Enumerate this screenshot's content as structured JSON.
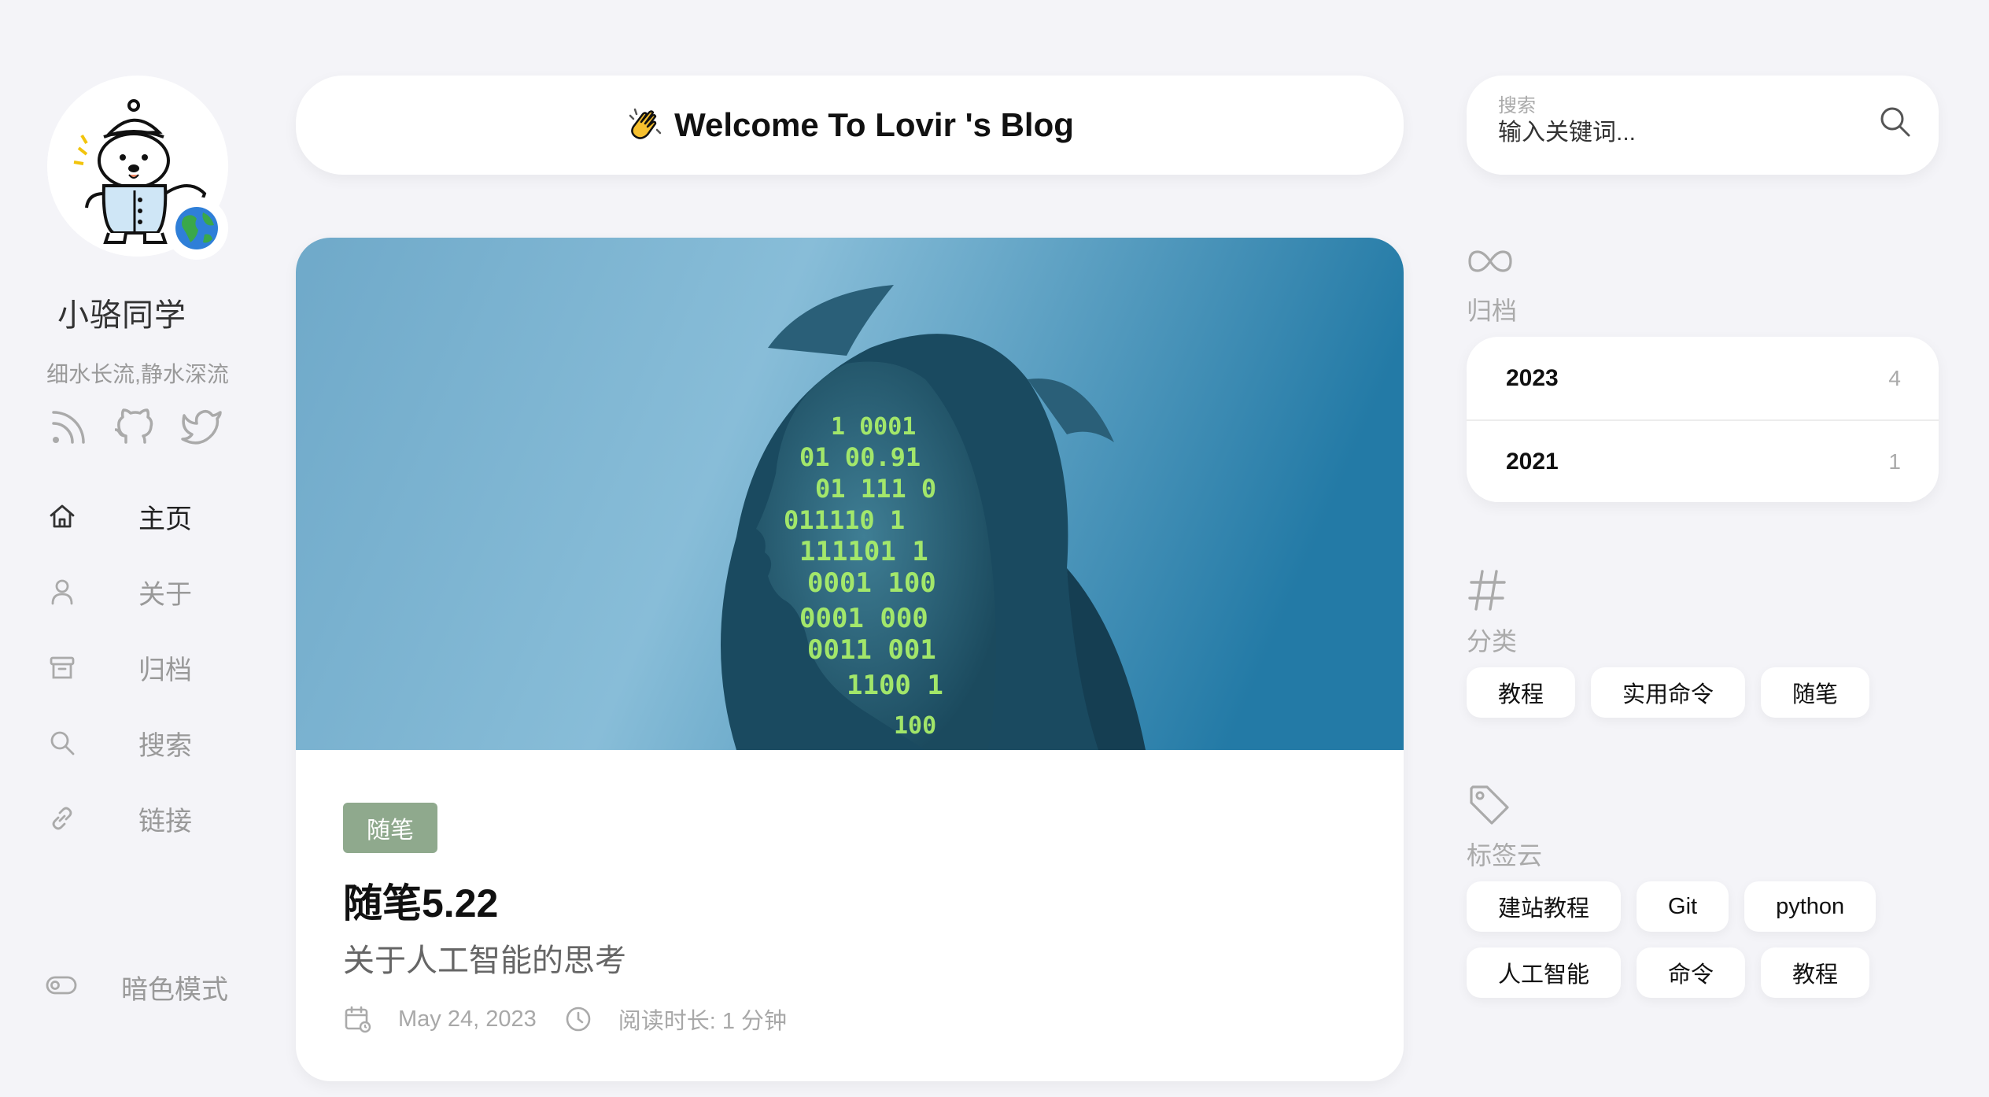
{
  "sidebar": {
    "author": "小骆同学",
    "motto": "细水长流,静水深流",
    "socials": [
      {
        "icon": "rss-icon"
      },
      {
        "icon": "github-icon"
      },
      {
        "icon": "twitter-icon"
      }
    ],
    "nav": [
      {
        "label": "主页",
        "icon": "home-icon"
      },
      {
        "label": "关于",
        "icon": "user-icon"
      },
      {
        "label": "归档",
        "icon": "archive-icon"
      },
      {
        "label": "搜索",
        "icon": "search-icon"
      },
      {
        "label": "链接",
        "icon": "link-icon"
      }
    ],
    "dark_mode_label": "暗色模式"
  },
  "banner": {
    "emoji": "👏",
    "title": "Welcome To Lovir 's Blog"
  },
  "post": {
    "category": "随笔",
    "title": "随笔5.22",
    "subtitle": "关于人工智能的思考",
    "date": "May 24, 2023",
    "read_time": "阅读时长: 1 分钟"
  },
  "search": {
    "label": "搜索",
    "placeholder": "输入关键词..."
  },
  "archive": {
    "title": "归档",
    "items": [
      {
        "year": "2023",
        "count": "4"
      },
      {
        "year": "2021",
        "count": "1"
      }
    ]
  },
  "categories": {
    "title": "分类",
    "items": [
      "教程",
      "实用命令",
      "随笔"
    ]
  },
  "tags": {
    "title": "标签云",
    "items": [
      "建站教程",
      "Git",
      "python",
      "人工智能",
      "命令",
      "教程"
    ]
  },
  "colors": {
    "background": "#f4f4f8",
    "card": "#ffffff",
    "category_badge": "#8fa98d",
    "muted_text": "#aaaaaa"
  }
}
